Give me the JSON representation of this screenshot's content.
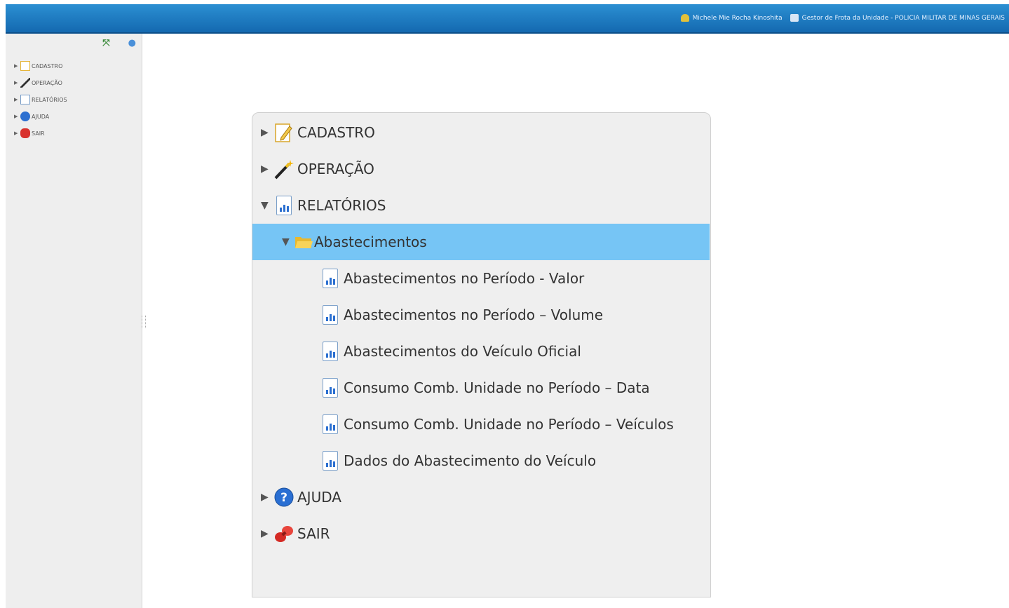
{
  "header": {
    "user_name": "Michele Mie Rocha Kinoshita",
    "role": "Gestor de Frota da Unidade - POLICIA MILITAR DE MINAS GERAIS"
  },
  "sidebar": {
    "items": [
      {
        "label": "CADASTRO",
        "icon": "pencil-note-icon"
      },
      {
        "label": "OPERAÇÃO",
        "icon": "magic-wand-icon"
      },
      {
        "label": "RELATÓRIOS",
        "icon": "report-icon"
      },
      {
        "label": "AJUDA",
        "icon": "help-icon"
      },
      {
        "label": "SAIR",
        "icon": "exit-icon"
      }
    ]
  },
  "menu": {
    "cadastro": "CADASTRO",
    "operacao": "OPERAÇÃO",
    "relatorios": "RELATÓRIOS",
    "abastecimentos": "Abastecimentos",
    "reports": [
      "Abastecimentos no Período - Valor",
      "Abastecimentos no Período – Volume",
      "Abastecimentos do Veículo Oficial",
      "Consumo Comb. Unidade no Período – Data",
      "Consumo Comb. Unidade no Período – Veículos",
      "Dados do Abastecimento do Veículo"
    ],
    "ajuda": "AJUDA",
    "sair": "SAIR"
  },
  "colors": {
    "header": "#1a74bd",
    "selected": "#76c5f5",
    "panel": "#efefef"
  }
}
